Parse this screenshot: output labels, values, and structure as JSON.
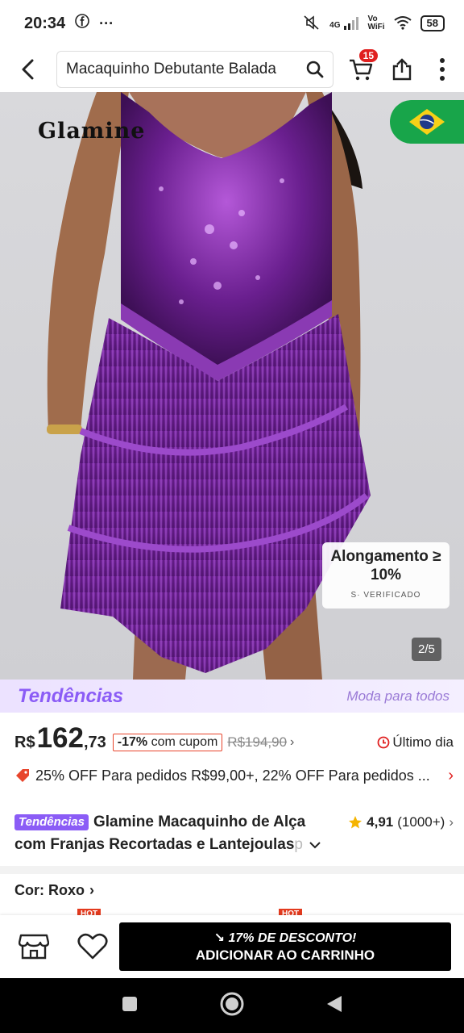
{
  "status_bar": {
    "time": "20:34",
    "network_top": "4G",
    "vowifi_top": "Vo",
    "vowifi_bottom": "WiFi",
    "battery": "58"
  },
  "header": {
    "search_text": "Macaquinho Debutante Balada",
    "cart_count": "15"
  },
  "product_image": {
    "brand": "Glamine",
    "stretch_title": "Alongamento ≥ 10%",
    "stretch_verified": "S· VERIFICADO",
    "counter": "2/5"
  },
  "trends": {
    "logo": "Tendências",
    "slogan": "Moda para todos"
  },
  "price": {
    "prefix": "R$",
    "integer": "162",
    "cents": ",73",
    "discount_percent": "-17%",
    "discount_label": " com cupom",
    "old_price": "R$194,90",
    "last_day": "Último dia"
  },
  "promo": {
    "text": "25% OFF Para pedidos R$99,00+,  22% OFF Para pedidos ..."
  },
  "title": {
    "chip": "Tendências",
    "line1": "Glamine Macaquinho de Alça",
    "line2": "com Franjas Recortadas e Lantejoulas",
    "line2_fade": " p",
    "rating": "4,91",
    "rating_count": "(1000+)"
  },
  "color": {
    "label": "Cor: Roxo"
  },
  "hot_tags": [
    "HOT",
    "HOT"
  ],
  "bottom_bar": {
    "discount_line": "17% DE DESCONTO!",
    "add_to_cart": "ADICIONAR AO CARRINHO"
  },
  "colors": {
    "accent_purple": "#8b5cf6",
    "discount_red": "#e8452c",
    "star_yellow": "#f5b400",
    "brazil_green": "#18a54a",
    "dress_purple": "#6a1f8f"
  }
}
